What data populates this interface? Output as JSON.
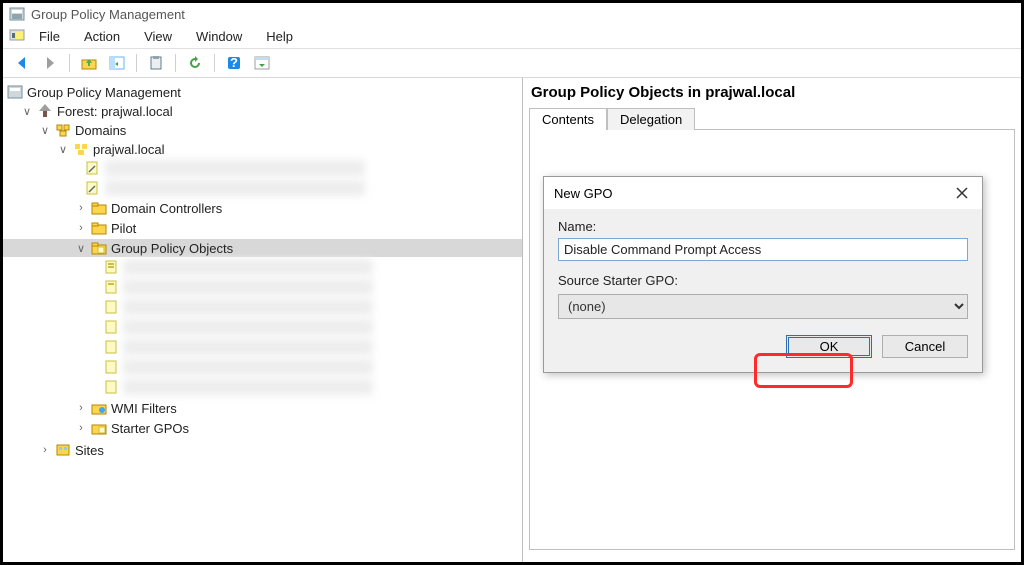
{
  "window": {
    "title": "Group Policy Management"
  },
  "menu": {
    "file": "File",
    "action": "Action",
    "view": "View",
    "window": "Window",
    "help": "Help"
  },
  "tree": {
    "root": "Group Policy Management",
    "forest": "Forest: prajwal.local",
    "domains": "Domains",
    "domain": "prajwal.local",
    "dc": "Domain Controllers",
    "pilot": "Pilot",
    "gpo": "Group Policy Objects",
    "wmi": "WMI Filters",
    "starter": "Starter GPOs",
    "sites": "Sites"
  },
  "right": {
    "title": "Group Policy Objects in prajwal.local",
    "tab_contents": "Contents",
    "tab_delegation": "Delegation"
  },
  "dialog": {
    "title": "New GPO",
    "name_label": "Name:",
    "name_value": "Disable Command Prompt Access",
    "starter_label": "Source Starter GPO:",
    "starter_value": "(none)",
    "ok": "OK",
    "cancel": "Cancel"
  }
}
